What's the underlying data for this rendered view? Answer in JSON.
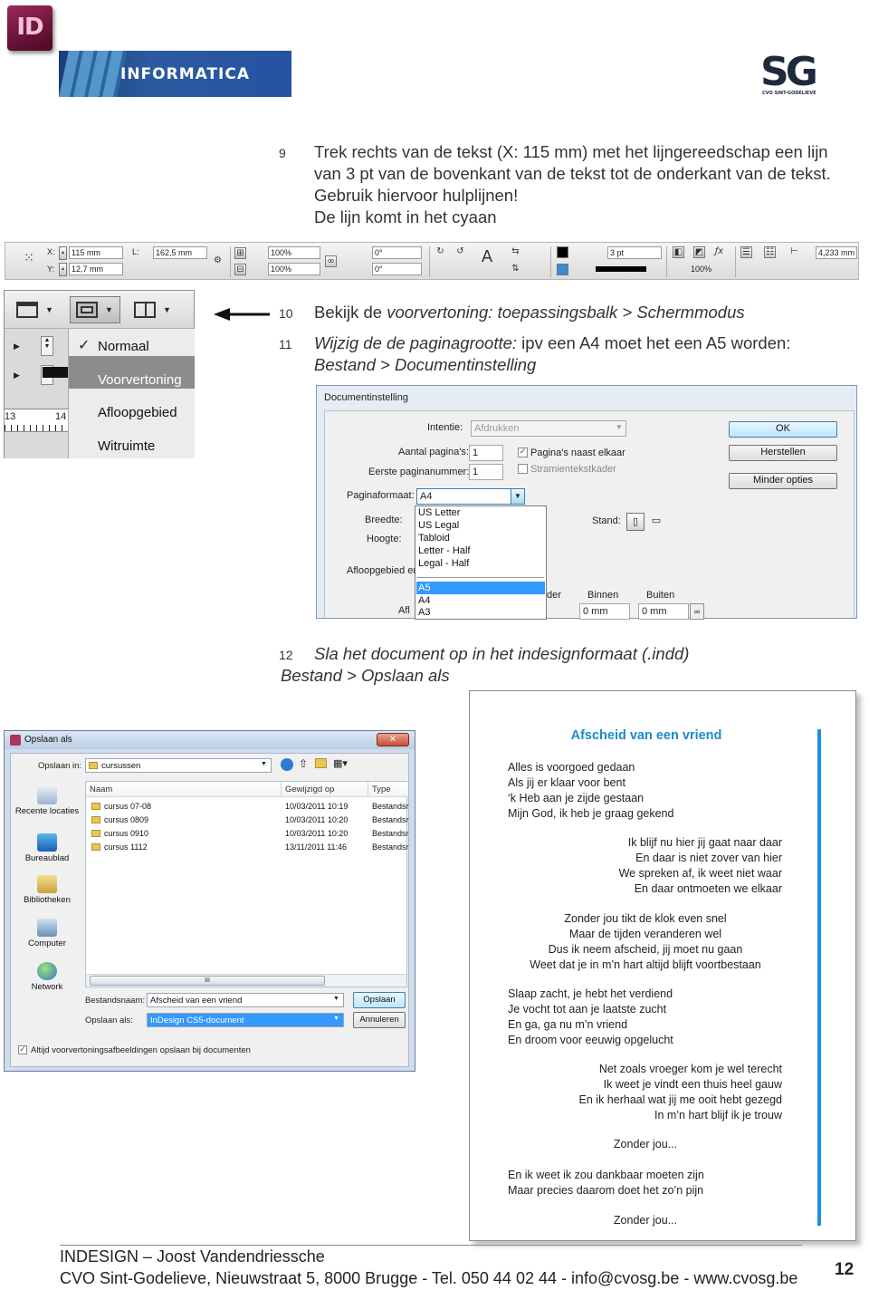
{
  "header": {
    "app_logo_text": "ID",
    "banner_text": "INFORMATICA",
    "school_logo_text": "SG",
    "school_logo_sub": "CVO SINT-GODELIEVE"
  },
  "steps": [
    {
      "num": "9",
      "lines": [
        "Trek rechts van de tekst (X: 115 mm) met het lijngereedschap een lijn",
        "van 3 pt van de bovenkant van de tekst tot de onderkant van de tekst.",
        "Gebruik hiervoor hulplijnen!",
        "De lijn komt in het cyaan"
      ]
    },
    {
      "num": "10",
      "prefix": "Bekijk de ",
      "italic": "voorvertoning: toepassingsbalk > Schermmodus"
    },
    {
      "num": "11",
      "italic_a": "Wijzig de de paginagrootte:",
      "mid": " ipv een A4 moet het een A5 worden:",
      "line2": "Bestand > Documentinstelling"
    },
    {
      "num": "12",
      "line1": "Sla het document op in het indesignformaat (.indd)",
      "line2": "Bestand > Opslaan als"
    }
  ],
  "control_bar": {
    "x_label": "X:",
    "y_label": "Y:",
    "x_value": "115 mm",
    "y_value": "12,7 mm",
    "l_label": "L:",
    "l_value": "162,5 mm",
    "scale_x": "100%",
    "scale_y": "100%",
    "rotation": "0°",
    "shear": "0°",
    "stroke_weight": "3 pt",
    "opacity": "100%",
    "offset": "4,233 mm"
  },
  "screen_mode_menu": {
    "items": [
      "Normaal",
      "Voorvertoning",
      "Afloopgebied",
      "Witruimte"
    ],
    "checked": "Normaal",
    "highlighted": "Voorvertoning",
    "ruler_marks": [
      "13",
      "14"
    ]
  },
  "doc_setup": {
    "title": "Documentinstelling",
    "intent_label": "Intentie:",
    "intent_value": "Afdrukken",
    "pages_label": "Aantal pagina's:",
    "pages_value": "1",
    "start_label": "Eerste paginanummer:",
    "start_value": "1",
    "facing_label": "Pagina's naast elkaar",
    "master_label": "Stramientekstkader",
    "format_label": "Paginaformaat:",
    "format_value": "A4",
    "width_label": "Breedte:",
    "height_label": "Hoogte:",
    "orientation_label": "Stand:",
    "bleed_label": "Afloopgebied en",
    "bleed2_label": "Afl",
    "inner_label": "Binnen",
    "outer_label": "Buiten",
    "inner_value": "0 mm",
    "outer_value": "0 mm",
    "partial_label": "der",
    "ok": "OK",
    "reset": "Herstellen",
    "fewer": "Minder opties",
    "sizes_top": [
      "US Letter",
      "US Legal",
      "Tabloid",
      "Letter - Half",
      "Legal - Half"
    ],
    "sizes_bottom": [
      "A5",
      "A4",
      "A3"
    ],
    "selected_size": "A5"
  },
  "save_dialog": {
    "title": "Opslaan als",
    "close": "✕",
    "save_in_label": "Opslaan in:",
    "save_in_value": "cursussen",
    "places": [
      "Recente locaties",
      "Bureaublad",
      "Bibliotheken",
      "Computer",
      "Network"
    ],
    "columns": [
      "Naam",
      "Gewijzigd op",
      "Type"
    ],
    "files": [
      {
        "name": "cursus 07-08",
        "date": "10/03/2011 10:19",
        "type": "Bestandsr"
      },
      {
        "name": "cursus 0809",
        "date": "10/03/2011 10:20",
        "type": "Bestandsr"
      },
      {
        "name": "cursus 0910",
        "date": "10/03/2011 10:20",
        "type": "Bestandsr"
      },
      {
        "name": "cursus 1112",
        "date": "13/11/2011 11:46",
        "type": "Bestandsr"
      }
    ],
    "filename_label": "Bestandsnaam:",
    "filename_value": "Afscheid van een vriend",
    "type_label": "Opslaan als:",
    "type_value": "InDesign CS5-document",
    "save_btn": "Opslaan",
    "cancel_btn": "Annuleren",
    "thumb_option": "Altijd voorvertoningsafbeeldingen opslaan bij documenten",
    "scroll_marker": "III"
  },
  "poem": {
    "title": "Afscheid van een vriend",
    "stanza1": [
      "Alles is voorgoed gedaan",
      "Als jij er klaar voor bent",
      "‘k Heb aan je zijde gestaan",
      "Mijn God, ik heb je graag gekend"
    ],
    "stanza2": [
      "Ik blijf nu hier jij gaat naar daar",
      "En daar is niet zover van hier",
      "We spreken af, ik weet niet waar",
      "En daar ontmoeten we elkaar"
    ],
    "stanza3": [
      "Zonder jou tikt de klok even snel",
      "Maar de tijden veranderen wel",
      "Dus ik neem afscheid, jij moet nu gaan",
      "Weet dat je in m’n hart altijd blijft voortbestaan"
    ],
    "stanza4": [
      "Slaap zacht, je hebt het verdiend",
      "Je vocht tot aan je laatste zucht",
      "En ga, ga nu m’n vriend",
      "En droom voor eeuwig opgelucht"
    ],
    "stanza5": [
      "Net zoals vroeger kom je wel terecht",
      "Ik weet je vindt een thuis heel gauw",
      "En ik herhaal wat jij me ooit hebt gezegd",
      "In m’n hart blijf ik je trouw"
    ],
    "refrain1": "Zonder jou...",
    "stanza6": [
      "En ik weet ik zou dankbaar moeten zijn",
      "Maar precies daarom doet het zo’n pijn"
    ],
    "refrain2": "Zonder jou..."
  },
  "footer": {
    "line1": "INDESIGN –  Joost Vandendriessche",
    "line2": "CVO Sint-Godelieve, Nieuwstraat 5, 8000 Brugge - Tel. 050 44 02 44 - info@cvosg.be - www.cvosg.be",
    "page": "12"
  }
}
